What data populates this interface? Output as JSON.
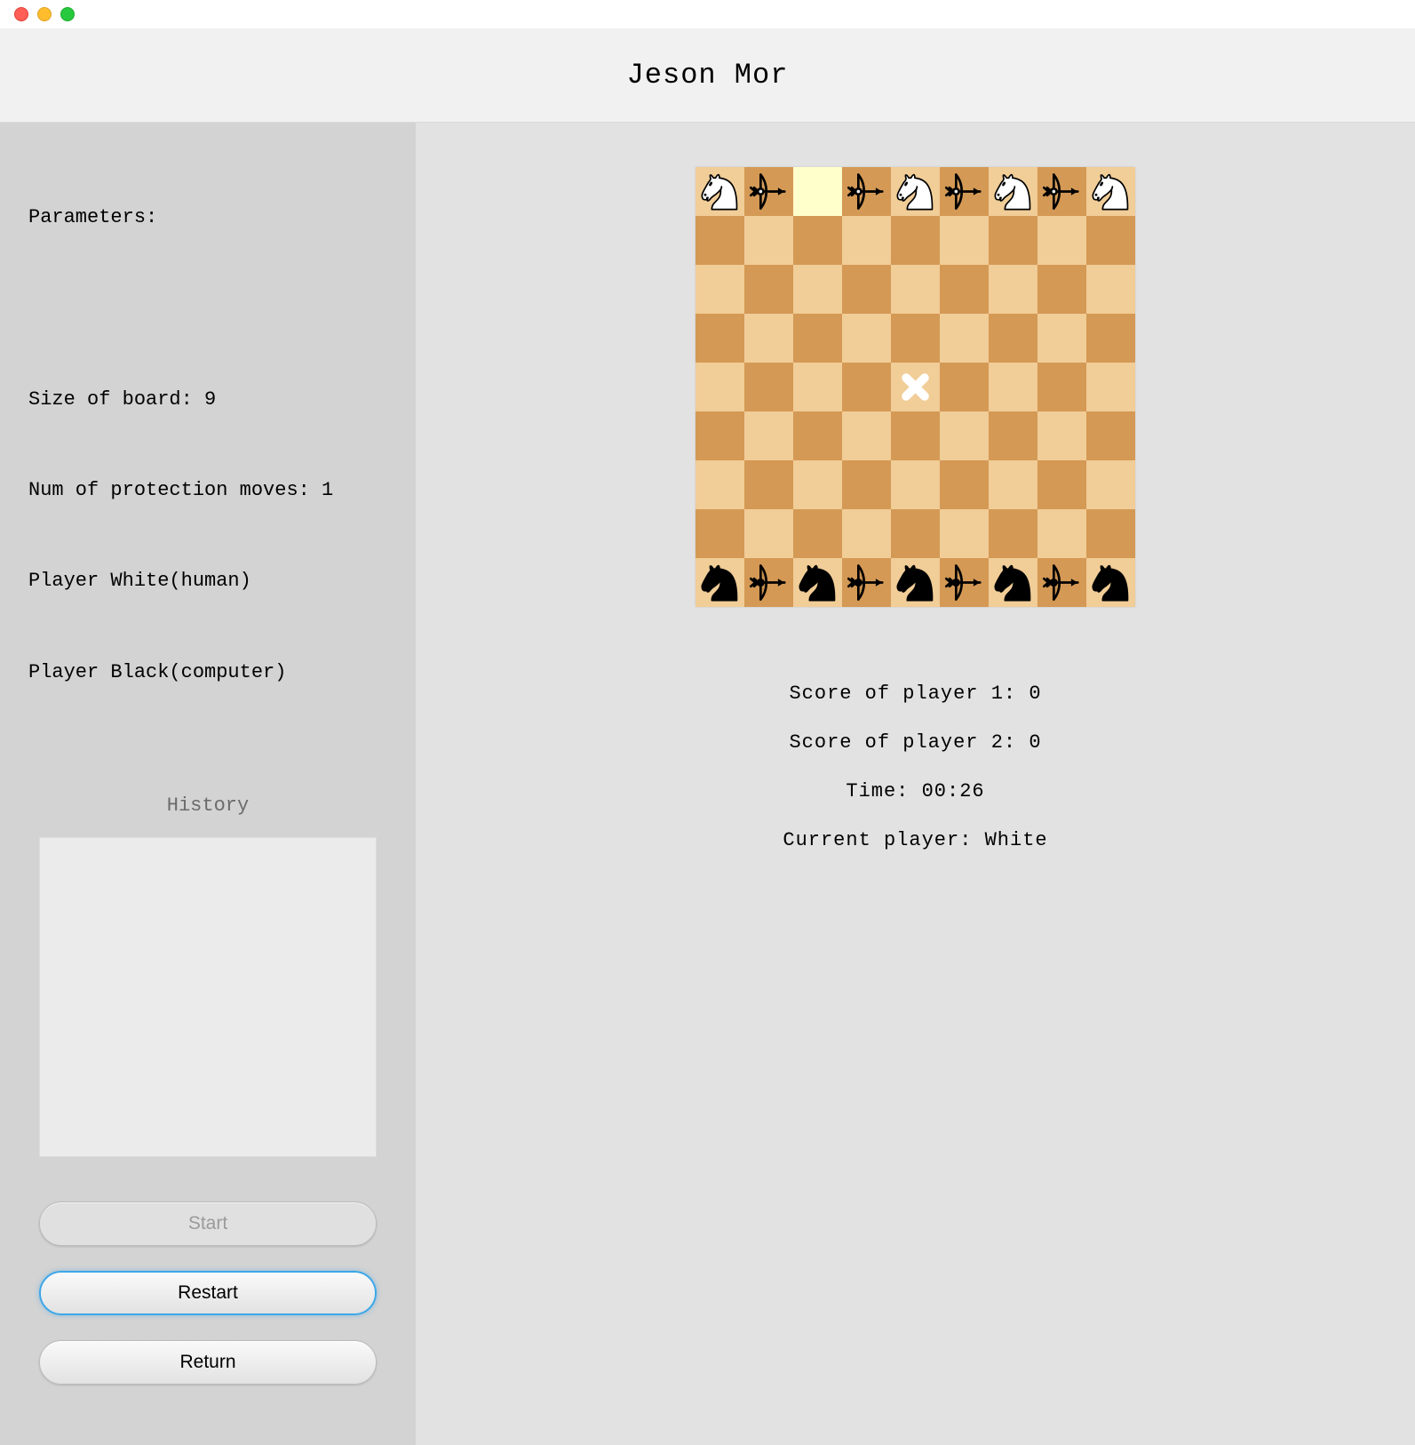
{
  "window": {
    "title": "Jeson Mor"
  },
  "sidebar": {
    "heading": "Parameters:",
    "lines": [
      "Size of board: 9",
      "Num of protection moves: 1",
      "Player White(human)",
      "Player Black(computer)"
    ],
    "history_title": "History",
    "history": "",
    "start_label": "Start",
    "restart_label": "Restart",
    "return_label": "Return"
  },
  "board": {
    "size": 9,
    "selected": {
      "row": 0,
      "col": 2
    },
    "center_marker": {
      "row": 4,
      "col": 4
    },
    "pieces_top": [
      "knight",
      "archer",
      "",
      "archer",
      "knight",
      "archer",
      "knight",
      "archer",
      "knight"
    ],
    "top_color": "white",
    "pieces_bottom": [
      "knight",
      "archer",
      "knight",
      "archer",
      "knight",
      "archer",
      "knight",
      "archer",
      "knight"
    ],
    "bottom_color": "black"
  },
  "status": {
    "score1_label": "Score of player 1: ",
    "score1": "0",
    "score2_label": "Score of player 2: ",
    "score2": "0",
    "time_label": "Time: ",
    "time": "00:26",
    "current_label": "Current player: ",
    "current": "White"
  }
}
